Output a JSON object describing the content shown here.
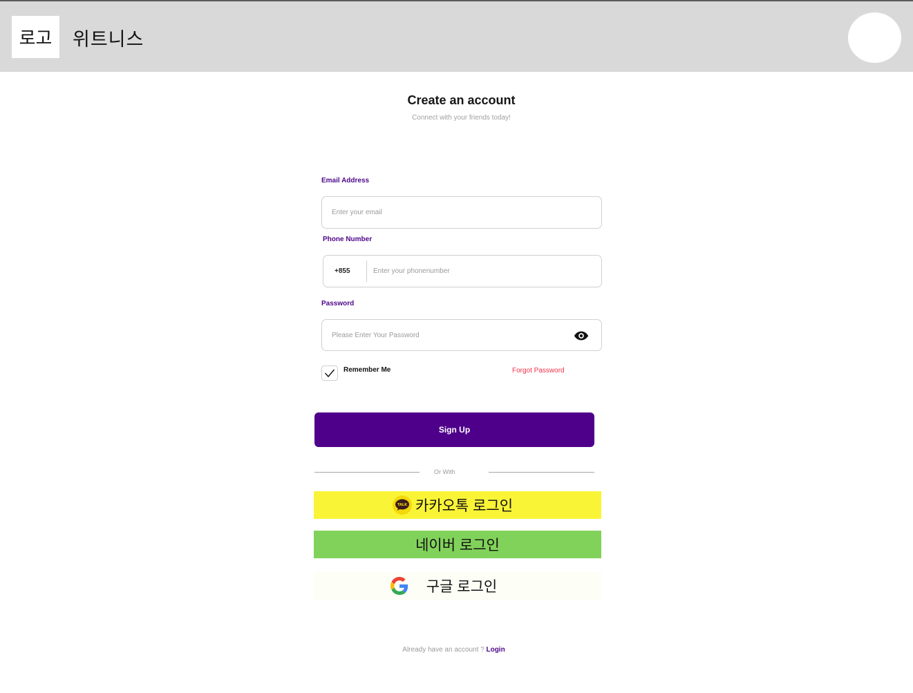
{
  "header": {
    "logo_text": "로고",
    "app_name": "위트니스"
  },
  "form": {
    "title": "Create an account",
    "subtitle": "Connect with your friends today!",
    "email_label": "Email Address",
    "email_placeholder": "Enter your email",
    "phone_label": "Phone Number",
    "phone_code": "+855",
    "phone_placeholder": "Enter your phonenumber",
    "password_label": "Password",
    "password_placeholder": "Please Enter Your Password",
    "remember_label": "Remember Me",
    "remember_checked": true,
    "forgot_label": "Forgot Password",
    "signup_label": "Sign Up",
    "divider_text": "Or With"
  },
  "social": {
    "kakao_label": "카카오톡 로그인",
    "kakao_badge_text": "TALK",
    "naver_label": "네이버 로그인",
    "google_label": "구글 로그인"
  },
  "footer": {
    "prompt": "Already have an account ? ",
    "login_label": "Login"
  },
  "colors": {
    "header_bg": "#d9d9d9",
    "accent": "#4e008a",
    "forgot": "#f0304a",
    "kakao": "#faf437",
    "naver": "#81d25a",
    "google_bg": "#fdfef6"
  }
}
